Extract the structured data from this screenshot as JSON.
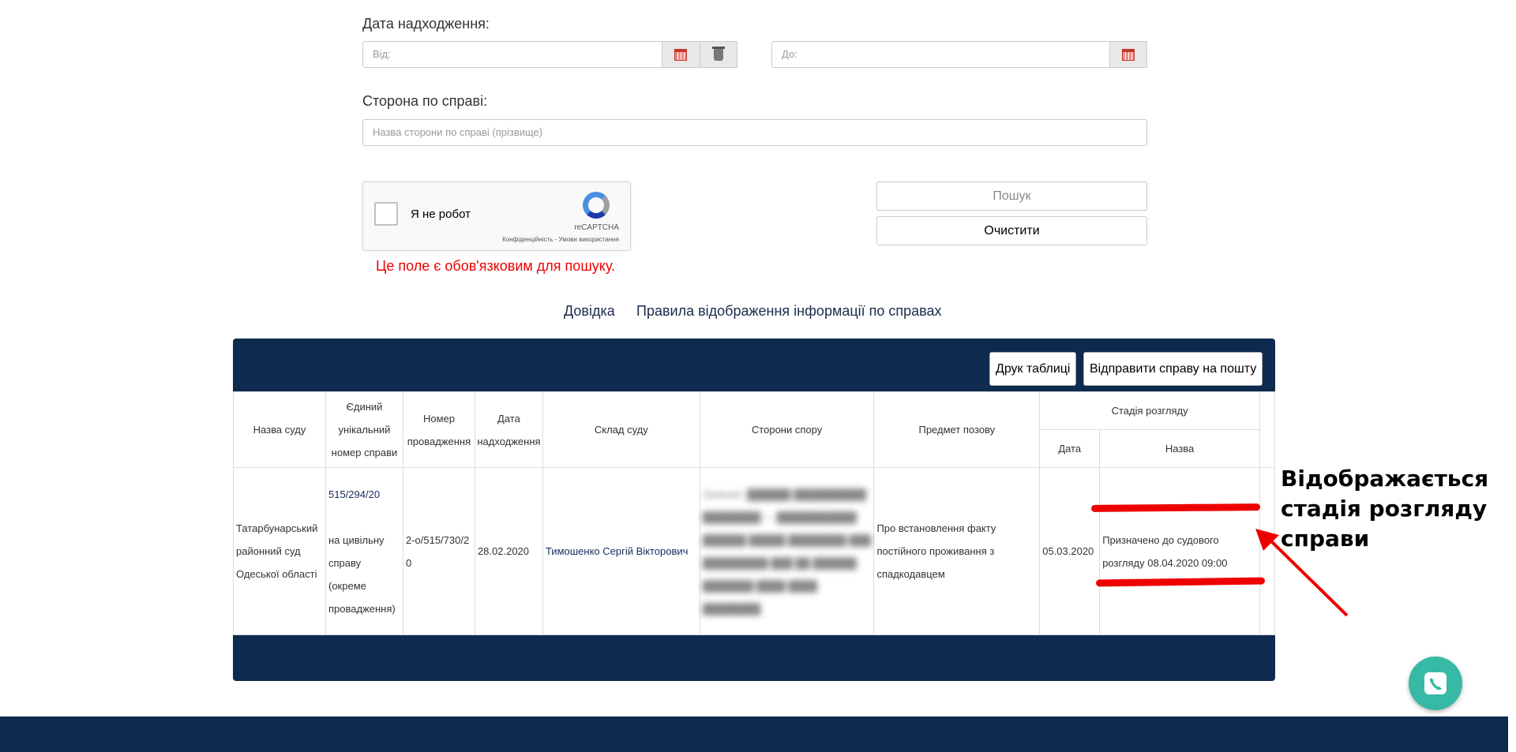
{
  "filters": {
    "date_label": "Дата надходження:",
    "from_placeholder": "Від:",
    "to_placeholder": "До:",
    "party_label": "Сторона по справі:",
    "party_placeholder": "Назва сторони по справі (прізвище)"
  },
  "captcha": {
    "label": "Я не робот",
    "brand": "reCAPTCHA",
    "terms": "Конфіденційність - Умови використання"
  },
  "buttons": {
    "search": "Пошук",
    "clear": "Очистити"
  },
  "error": "Це поле є обов'язковим для пошуку.",
  "links": {
    "help": "Довідка",
    "rules": "Правила відображення інформації по справах"
  },
  "toolbar": {
    "print": "Друк таблиці",
    "send": "Відправити справу на пошту"
  },
  "table": {
    "headers": {
      "court": "Назва суду",
      "unique": "Єдиний унікальний номер справи",
      "number": "Номер провадження",
      "date": "Дата надходження",
      "judges": "Склад суду",
      "parties": "Сторони спору",
      "subject": "Предмет позову",
      "stage": "Стадія розгляду",
      "stage_date": "Дата",
      "stage_name": "Назва"
    },
    "row": {
      "court": "Татарбунарський районний суд Одеської області",
      "unique_no": "515/294/20",
      "unique_desc": "на цивільну справу (окреме провадження)",
      "number": "2-о/515/730/20",
      "date": "28.02.2020",
      "judges": "Тимошенко Сергій Вікторович",
      "parties": "Заявник: ██████ ██████████ ████████ — ███████████ ██████ █████ ████████ ███ █████████ ███ ██ ██████ ███████ ████ ████ ████████",
      "subject": "Про встановлення факту постійного проживання з спадкодавцем",
      "stage_date": "05.03.2020",
      "stage_name": "Призначено до судового розгляду 08.04.2020 09:00"
    }
  },
  "annotation": "Відображається стадія розгляду справи",
  "colors": {
    "navy": "#0f2a4f",
    "red": "#ee0000",
    "teal": "#36b9a5"
  },
  "icons": [
    "calendar-icon",
    "trash-icon",
    "recaptcha-icon",
    "phone-icon",
    "arrow-icon"
  ]
}
